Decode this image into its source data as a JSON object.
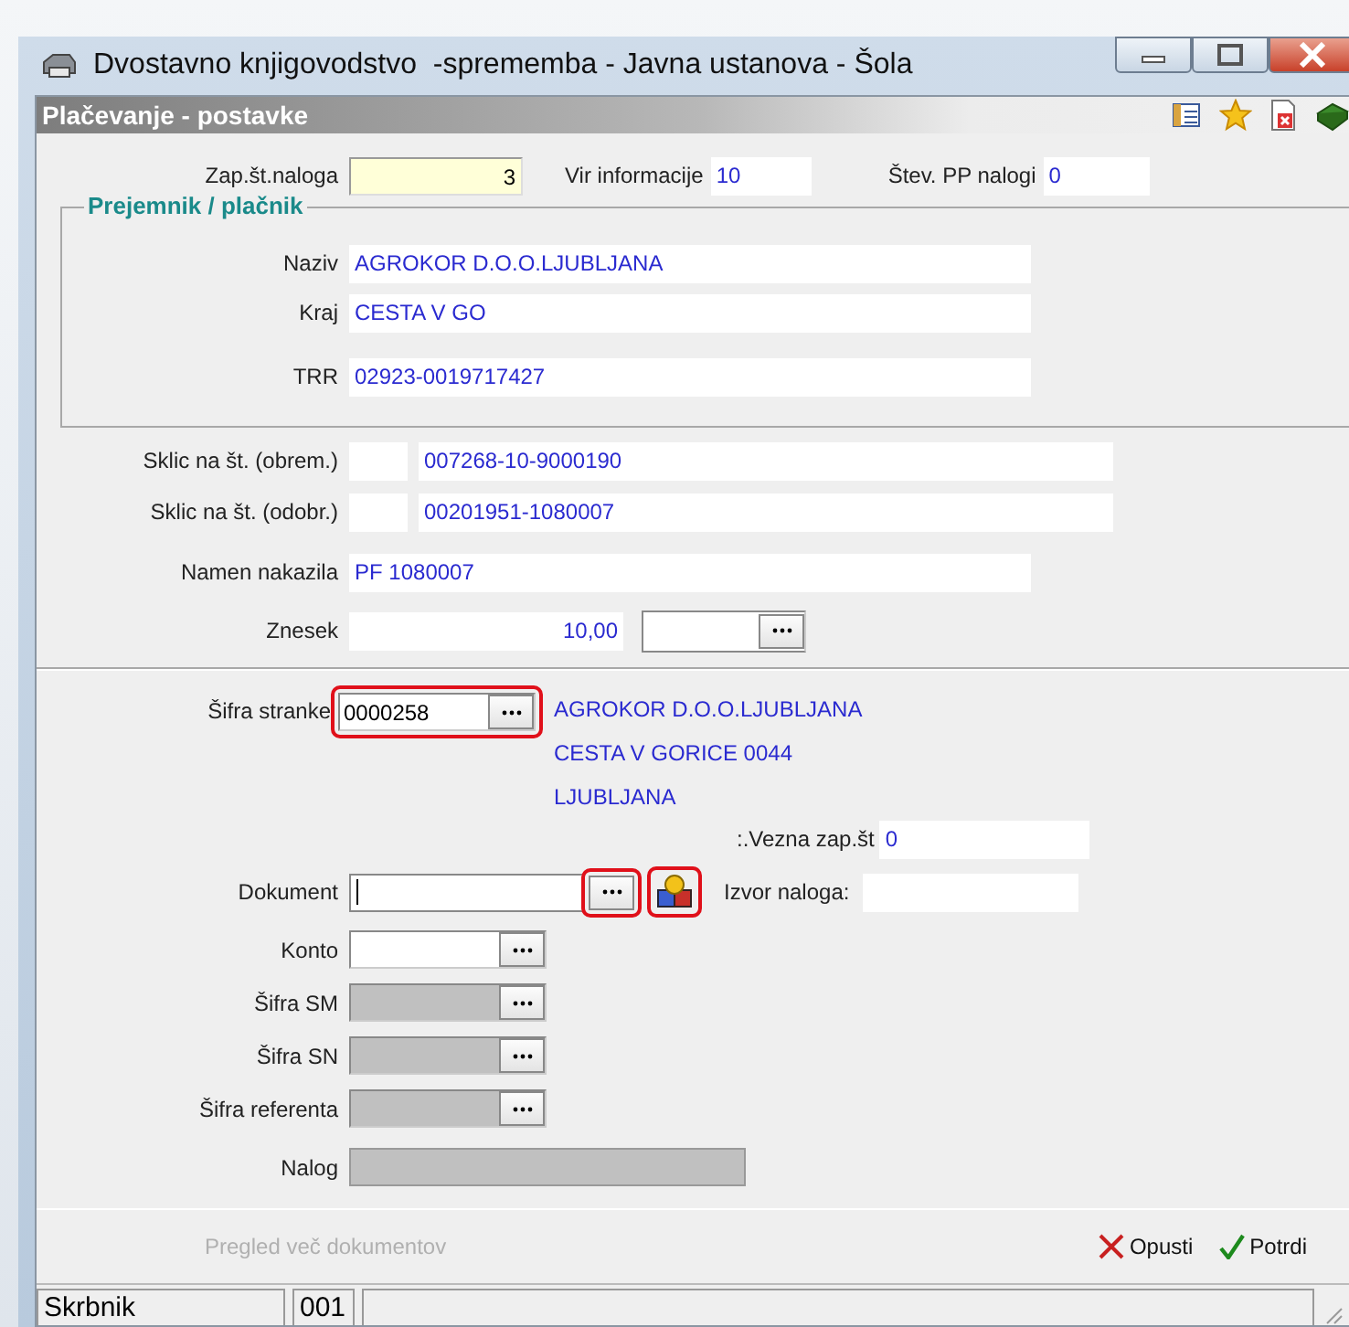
{
  "window": {
    "title": "Dvostavno knjigovodstvo  -sprememba - Javna ustanova - Šola"
  },
  "panel": {
    "title": "Plačevanje - postavke"
  },
  "top_fields": [
    {
      "kind": "number",
      "label": "Zap.št.naloga",
      "value": "3"
    },
    {
      "kind": "text",
      "label": "Vir informacije",
      "value": "10"
    },
    {
      "kind": "text",
      "label": "Štev. PP nalogi",
      "value": "0"
    }
  ],
  "recipient": {
    "title": "Prejemnik / plačnik",
    "rows": [
      {
        "label": "Naziv",
        "value": "AGROKOR D.O.O.LJUBLJANA"
      },
      {
        "label": "Kraj",
        "value": "CESTA V GO"
      },
      {
        "label": "TRR",
        "value": "02923-0019717427"
      }
    ]
  },
  "references": [
    {
      "label": "Sklic na št. (obrem.)",
      "value": "007268-10-9000190"
    },
    {
      "label": "Sklic na št. (odobr.)",
      "value": "00201951-1080007"
    }
  ],
  "purpose": {
    "label": "Namen nakazila",
    "value": "PF 1080007"
  },
  "amount": {
    "label": "Znesek",
    "value": "10,00"
  },
  "partner": {
    "label": "Šifra stranke",
    "value": "0000258",
    "highlighted": true,
    "lines": [
      "AGROKOR D.O.O.LJUBLJANA",
      "CESTA V GORICE 0044",
      "LJUBLJANA"
    ]
  },
  "link_no": {
    "label": ":.Vezna zap.št",
    "value": "0"
  },
  "document": {
    "label": "Dokument",
    "button_highlighted": true,
    "icon_highlighted": true
  },
  "order_source": {
    "label": "Izvor naloga:"
  },
  "lookups": [
    {
      "label": "Konto",
      "disabled": false,
      "kind": "lookup"
    },
    {
      "label": "Šifra SM",
      "disabled": true,
      "kind": "lookup"
    },
    {
      "label": "Šifra SN",
      "disabled": true,
      "kind": "lookup"
    },
    {
      "label": "Šifra referenta",
      "disabled": true,
      "kind": "lookup"
    },
    {
      "label": "Nalog",
      "disabled": true,
      "kind": "plain"
    }
  ],
  "footer": {
    "link": {
      "label": "Pregled več dokumentov",
      "disabled": true
    },
    "buttons": [
      {
        "kind": "cancel",
        "label": "Opusti"
      },
      {
        "kind": "confirm",
        "label": "Potrdi"
      }
    ]
  },
  "status_bar": [
    "Skrbnik",
    "001"
  ]
}
